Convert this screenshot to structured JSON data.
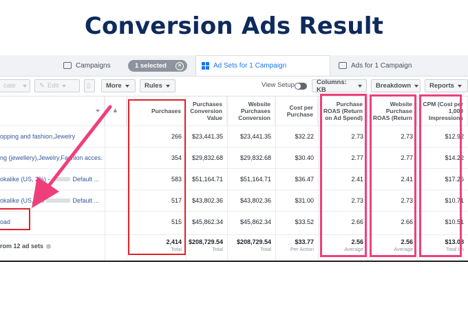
{
  "title": "Conversion Ads Result",
  "tabs": {
    "campaigns": "Campaigns",
    "selected": "1 selected",
    "adsets": "Ad Sets for 1 Campaign",
    "ads": "Ads for 1 Campaign"
  },
  "toolbar": {
    "duplicate": "cate",
    "edit": "Edit",
    "more": "More",
    "rules": "Rules",
    "view_setup": "View Setup",
    "columns": "Columns: KB",
    "breakdown": "Breakdown",
    "reports": "Reports"
  },
  "headers": {
    "purchases": "Purchases",
    "pcv": "Purchases Conversion Value",
    "wpcv": "Website Purchases Conversion",
    "cpp": "Cost per Purchase",
    "roas": "Purchase ROAS (Return on Ad Spend)",
    "wroas": "Website Purchase ROAS (Return",
    "cpm": "CPM (Cost per 1,000 Impressions"
  },
  "rows": [
    {
      "name": "opping and fashion,Jewelry",
      "purchases": "266",
      "pcv": "$23,441.35",
      "wpcv": "$23,441.35",
      "cpp": "$32.22",
      "roas": "2.73",
      "wroas": "2.73",
      "cpm": "$12.92"
    },
    {
      "name": "ng (jewellery),Jewelry,Fashion acces...",
      "purchases": "354",
      "pcv": "$29,832.68",
      "wpcv": "$29,832.68",
      "cpp": "$30.40",
      "roas": "2.77",
      "wroas": "2.77",
      "cpm": "$14.22"
    },
    {
      "name": "okalike (US, 2%) -",
      "name_tail": "Default ...",
      "purchases": "583",
      "pcv": "$51,164.71",
      "wpcv": "$51,164.71",
      "cpp": "$36.47",
      "roas": "2.41",
      "wroas": "2.41",
      "cpm": "$17.26"
    },
    {
      "name": "okalike (US, 8%",
      "name_tail": "Default ...",
      "purchases": "517",
      "pcv": "$43,802.36",
      "wpcv": "$43,802.36",
      "cpp": "$31.00",
      "roas": "2.73",
      "wroas": "2.73",
      "cpm": "$10.71"
    },
    {
      "name": "oad",
      "purchases": "515",
      "pcv": "$45,862.34",
      "wpcv": "$45,862.34",
      "cpp": "$33.52",
      "roas": "2.66",
      "wroas": "2.66",
      "cpm": "$10.51"
    }
  ],
  "totals": {
    "label": "rom 12 ad sets",
    "purchases": "2,414",
    "purchases_sub": "Total",
    "pcv": "$208,729.54",
    "pcv_sub": "Total",
    "wpcv": "$208,729.54",
    "wpcv_sub": "Total",
    "cpp": "$33.77",
    "cpp_sub": "Per Action",
    "roas": "2.56",
    "roas_sub": "Average",
    "wroas": "2.56",
    "wroas_sub": "Average",
    "cpm": "$13.08",
    "cpm_sub": "Total Im"
  },
  "colors": {
    "title": "#0f2a5c",
    "red_box": "#e0202a",
    "pink_box": "#ee3f7b",
    "arrow": "#ee3f7b",
    "link": "#365899"
  }
}
